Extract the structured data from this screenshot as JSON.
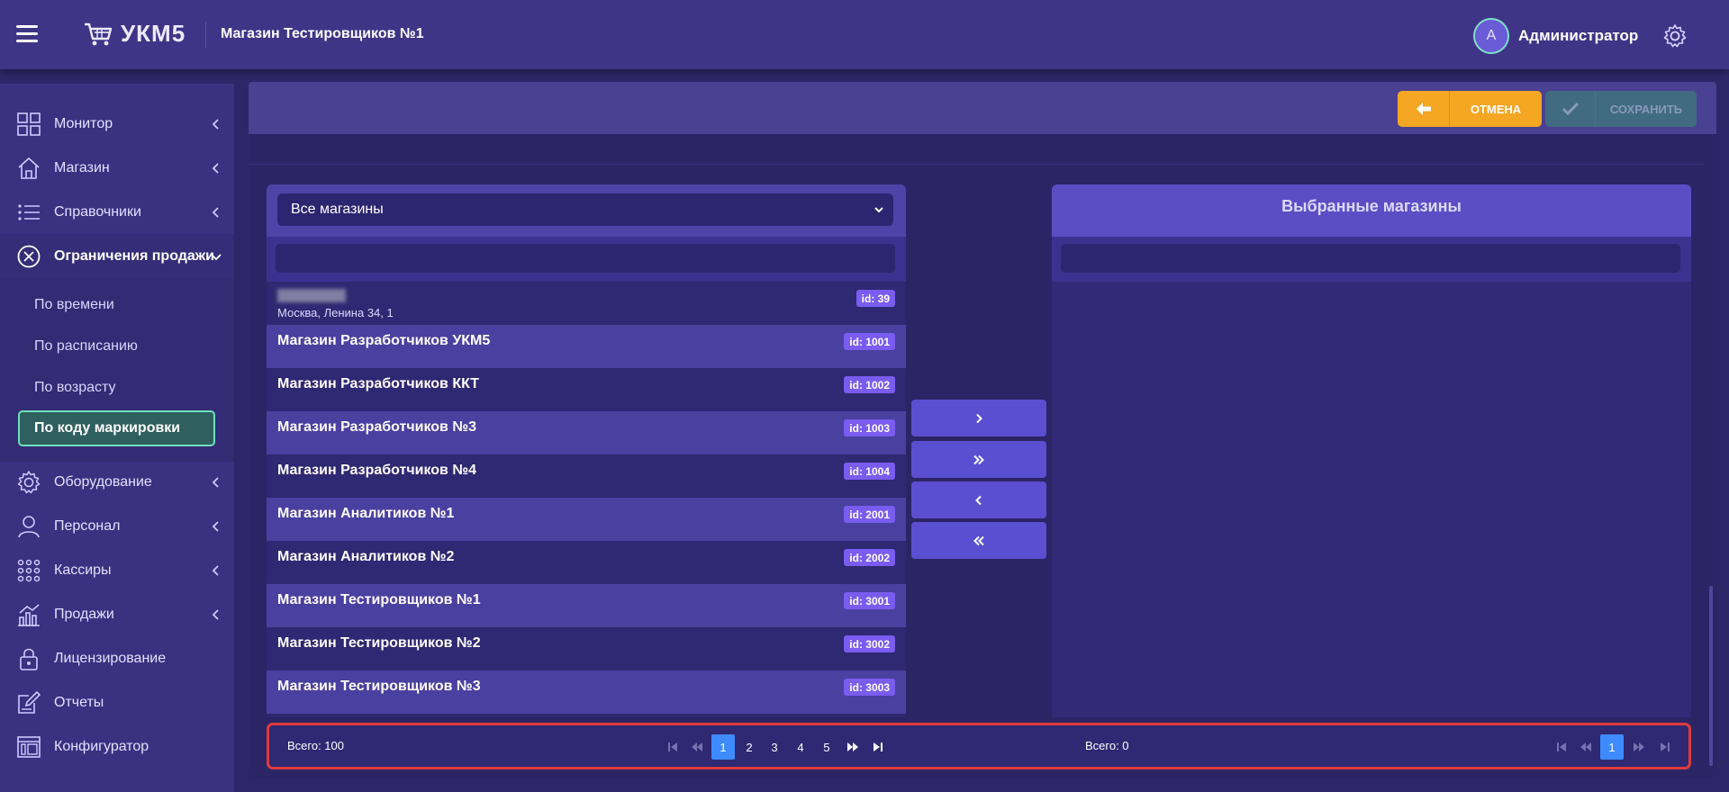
{
  "topbar": {
    "logo_text": "УКМ5",
    "store_title": "Магазин Тестировщиков №1",
    "user_initial": "А",
    "user_name": "Администратор"
  },
  "sidebar": {
    "items": [
      {
        "label": "Монитор",
        "icon": "monitor-grid-icon",
        "chevron": "left"
      },
      {
        "label": "Магазин",
        "icon": "store-house-icon",
        "chevron": "left"
      },
      {
        "label": "Справочники",
        "icon": "list-icon",
        "chevron": "left"
      },
      {
        "label": "Ограничения продажи",
        "icon": "restriction-circle-icon",
        "chevron": "down"
      },
      {
        "label": "Оборудование",
        "icon": "gear-icon",
        "chevron": "left"
      },
      {
        "label": "Персонал",
        "icon": "person-icon",
        "chevron": "left"
      },
      {
        "label": "Кассиры",
        "icon": "dots-grid-icon",
        "chevron": "left"
      },
      {
        "label": "Продажи",
        "icon": "sales-chart-icon",
        "chevron": "left"
      },
      {
        "label": "Лицензирование",
        "icon": "lock-icon",
        "chevron": "none"
      },
      {
        "label": "Отчеты",
        "icon": "report-edit-icon",
        "chevron": "none"
      },
      {
        "label": "Конфигуратор",
        "icon": "configurator-icon",
        "chevron": "none"
      }
    ],
    "submenu": [
      "По времени",
      "По расписанию",
      "По возрасту",
      "По коду маркировки"
    ]
  },
  "toolbar": {
    "cancel_label": "ОТМЕНА",
    "save_label": "СОХРАНИТЬ"
  },
  "left_panel": {
    "filter_value": "Все магазины",
    "search_placeholder": "",
    "rows": [
      {
        "name": "",
        "address": "Москва, Ленина 34, 1",
        "id": "id: 39",
        "redacted": true
      },
      {
        "name": "Магазин Разработчиков УКМ5",
        "id": "id: 1001"
      },
      {
        "name": "Магазин Разработчиков ККТ",
        "id": "id: 1002"
      },
      {
        "name": "Магазин Разработчиков №3",
        "id": "id: 1003"
      },
      {
        "name": "Магазин Разработчиков №4",
        "id": "id: 1004"
      },
      {
        "name": "Магазин Аналитиков №1",
        "id": "id: 2001"
      },
      {
        "name": "Магазин Аналитиков №2",
        "id": "id: 2002"
      },
      {
        "name": "Магазин Тестировщиков №1",
        "id": "id: 3001"
      },
      {
        "name": "Магазин Тестировщиков №2",
        "id": "id: 3002"
      },
      {
        "name": "Магазин Тестировщиков №3",
        "id": "id: 3003"
      }
    ],
    "total": "Всего: 100",
    "pages": [
      "1",
      "2",
      "3",
      "4",
      "5"
    ],
    "current_page": "1"
  },
  "right_panel": {
    "title": "Выбранные магазины",
    "search_placeholder": "",
    "total": "Всего: 0",
    "pages": [
      "1"
    ],
    "current_page": "1"
  },
  "colors": {
    "topbar": "#3f3587",
    "sidebar": "#3a3181",
    "accent_orange": "#f5a623",
    "save_teal": "#3e7a7c",
    "transfer_button": "#5a4fd0",
    "badge": "#7a5cf0",
    "active_page": "#3d8bff",
    "highlight_frame": "#e03a3a",
    "active_submenu_border": "#6ee0bd"
  }
}
